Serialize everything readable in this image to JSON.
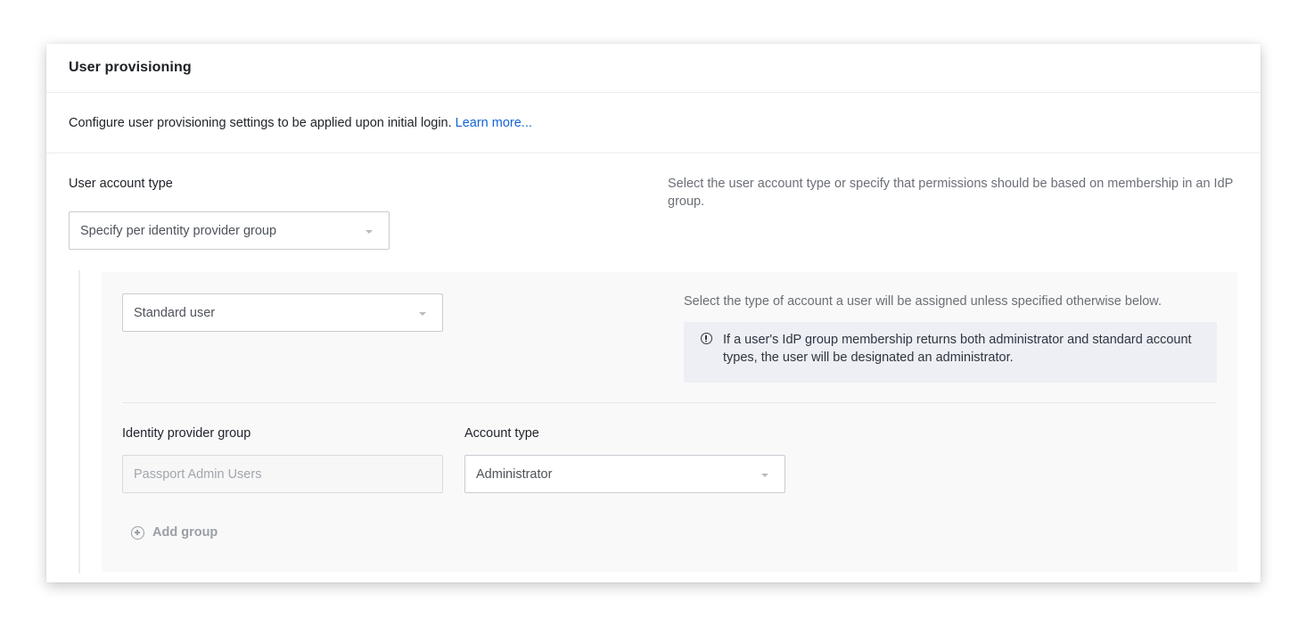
{
  "card": {
    "title": "User provisioning",
    "intro_text": "Configure user provisioning settings to be applied upon initial login.",
    "learn_more_label": "Learn more..."
  },
  "account_type": {
    "label": "User account type",
    "selected": "Specify per identity provider group",
    "help": "Select the user account type or specify that permissions should be based on membership in an IdP group."
  },
  "default_account": {
    "selected": "Standard user",
    "help": "Select the type of account a user will be assigned unless specified otherwise below.",
    "callout": "If a user's IdP group membership returns both administrator and standard account types, the user will be designated an administrator.",
    "callout_icon": "info-icon"
  },
  "group_mapping": {
    "group_label": "Identity provider group",
    "group_placeholder": "Passport Admin Users",
    "account_label": "Account type",
    "account_selected": "Administrator"
  },
  "add_group": {
    "label": "Add group",
    "icon": "plus-circle-icon"
  },
  "colors": {
    "link": "#1464d4",
    "callout_bg": "#edeff4",
    "panel_bg": "#f9f9fa"
  }
}
